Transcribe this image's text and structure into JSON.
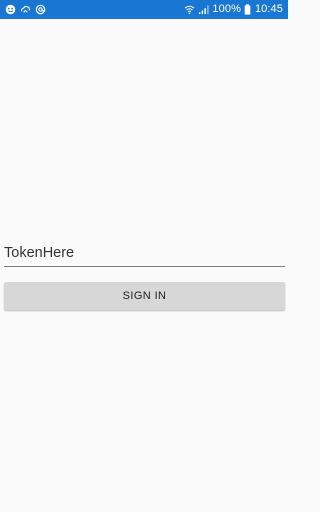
{
  "status_bar": {
    "background": "#1976d2",
    "left_icons": [
      "face-icon",
      "cloud-sync-icon",
      "at-icon"
    ],
    "right_icons": [
      "wifi-icon",
      "signal-icon",
      "battery-icon"
    ],
    "battery_percent": "100%",
    "time": "10:45"
  },
  "form": {
    "token_value": "TokenHere",
    "sign_in_label": "SIGN IN",
    "button_color": "#d7d7d7"
  }
}
